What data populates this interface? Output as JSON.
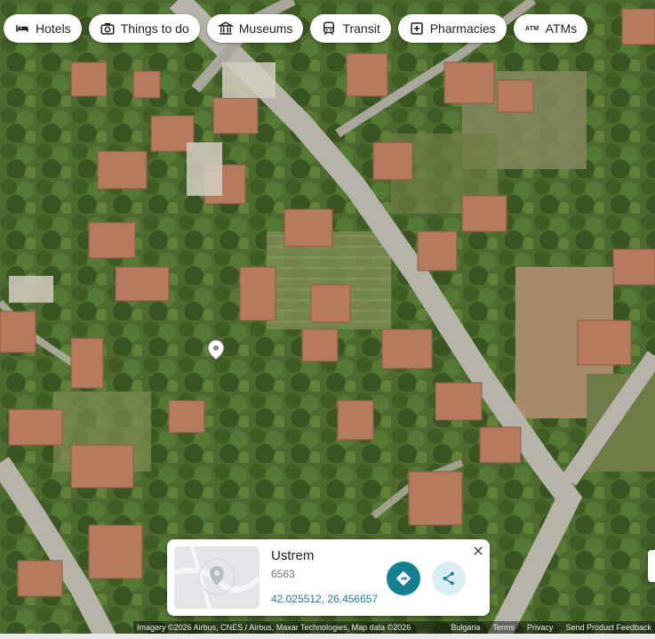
{
  "chips": [
    {
      "label": "Hotels",
      "icon": "bed-icon"
    },
    {
      "label": "Things to do",
      "icon": "camera-icon"
    },
    {
      "label": "Museums",
      "icon": "museum-icon"
    },
    {
      "label": "Transit",
      "icon": "transit-icon"
    },
    {
      "label": "Pharmacies",
      "icon": "pharmacy-icon"
    },
    {
      "label": "ATMs",
      "icon": "atm-icon",
      "icon_text": "ATM"
    }
  ],
  "card": {
    "title": "Ustrem",
    "subtitle": "6563",
    "coordinates": "42.025512, 26.456657",
    "directions_icon": "directions-icon",
    "share_icon": "share-icon",
    "close_icon": "close-icon"
  },
  "attribution": {
    "imagery": "Imagery ©2026 Airbus, CNES / Airbus, Maxar Technologies, Map data ©2026",
    "region": "Bulgaria",
    "terms": "Terms",
    "privacy": "Privacy",
    "feedback": "Send Product Feedback"
  },
  "colors": {
    "accent": "#138192",
    "accent_light": "#d8eef2",
    "link": "#1e7d92"
  }
}
